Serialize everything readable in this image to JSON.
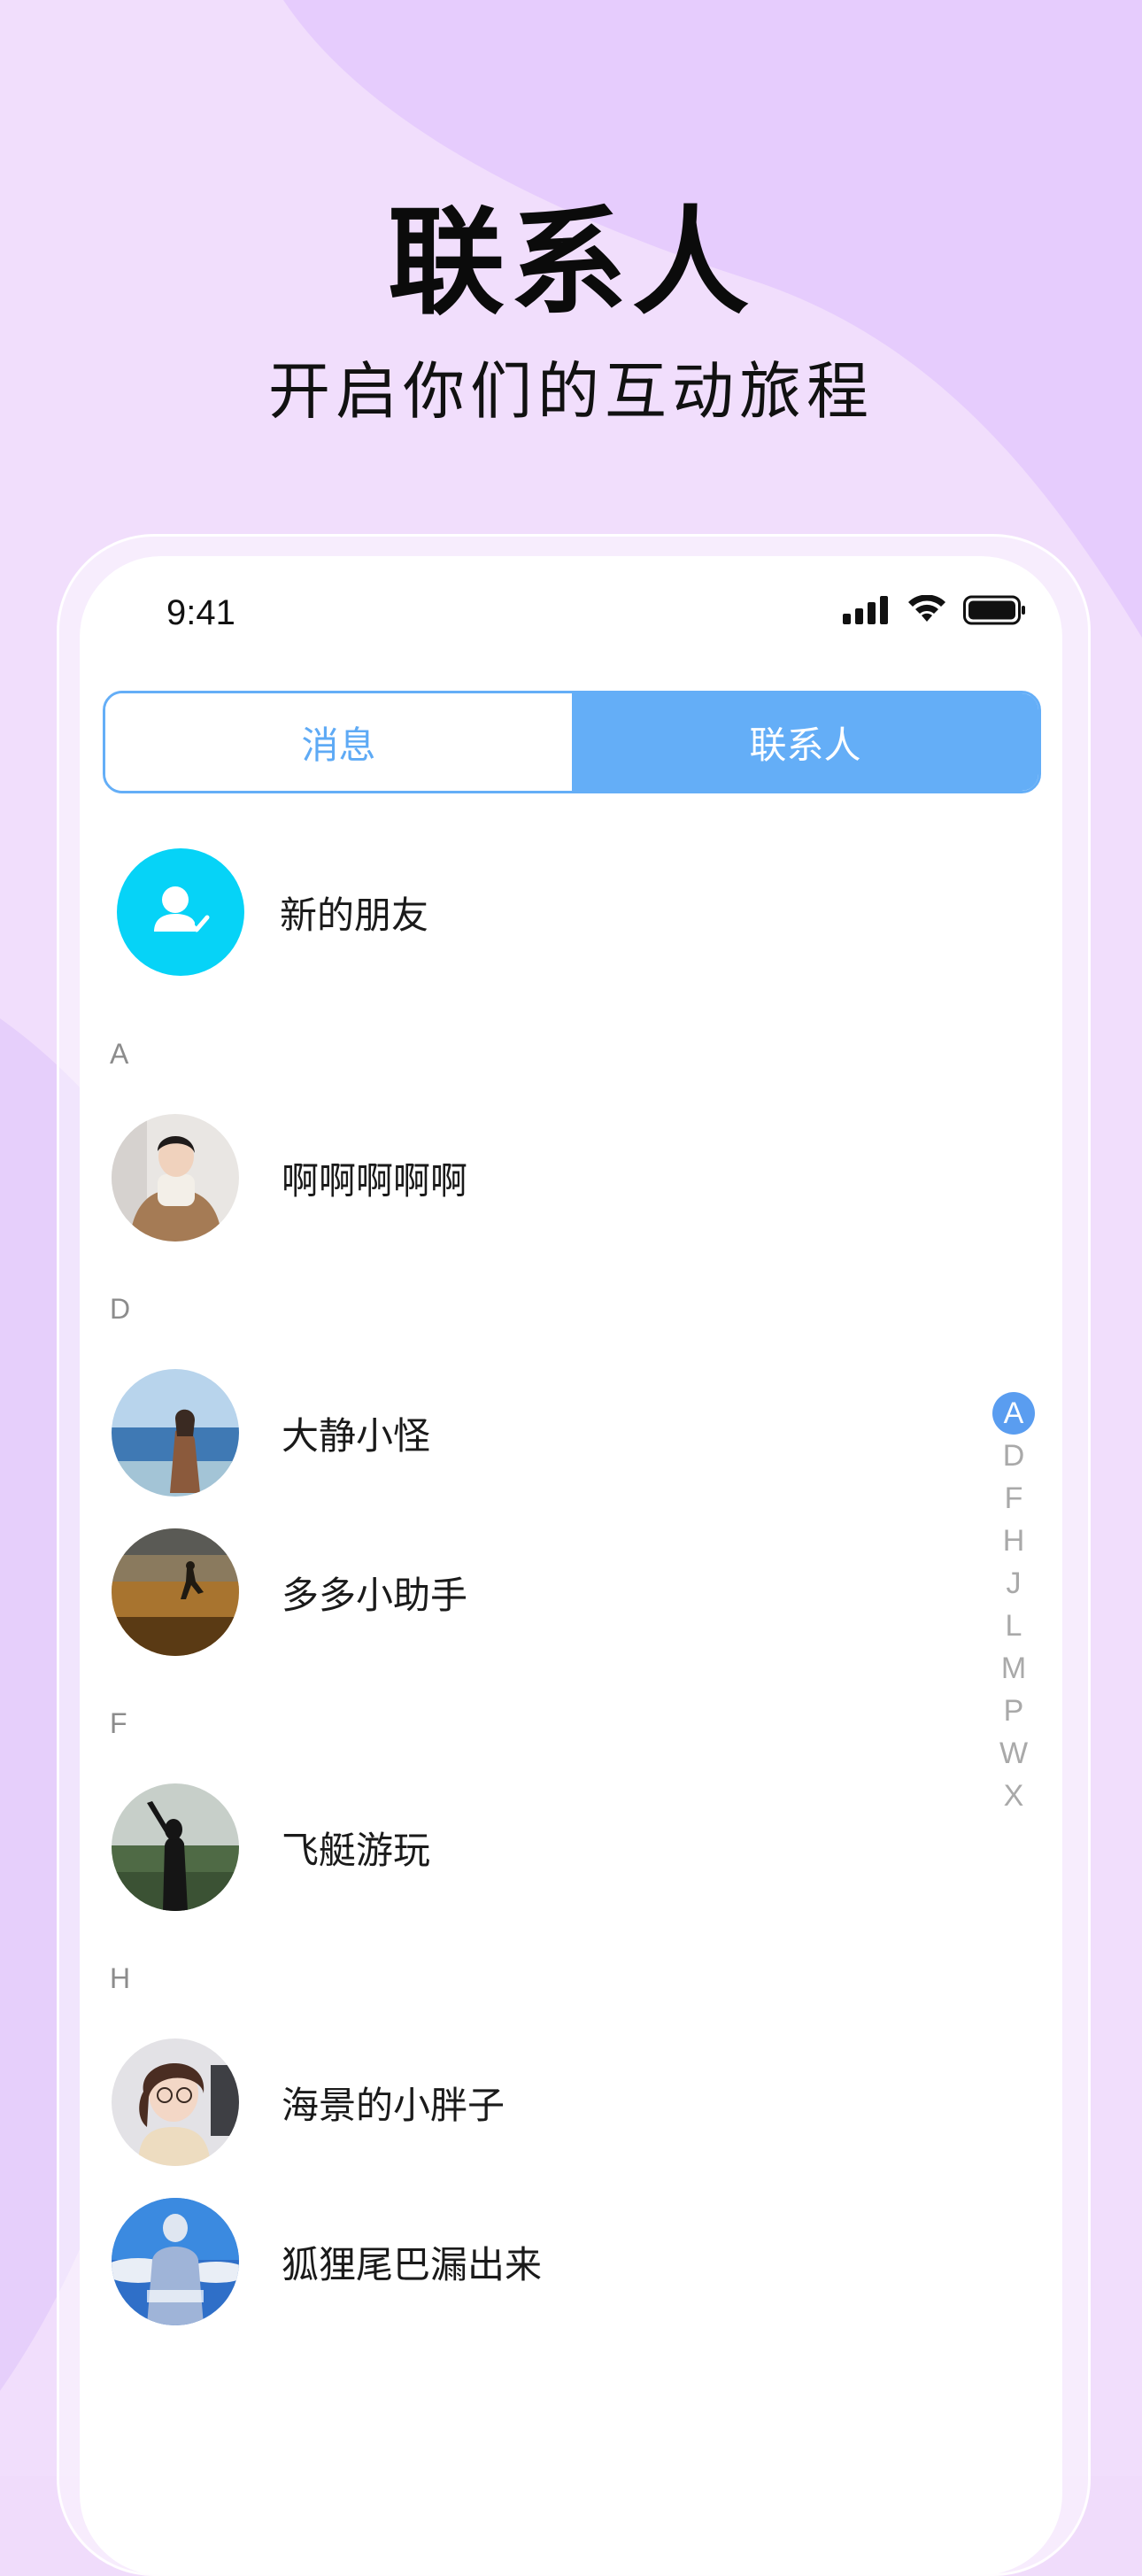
{
  "hero": {
    "title": "联系人",
    "subtitle": "开启你们的互动旅程"
  },
  "status_bar": {
    "time": "9:41"
  },
  "tabs": [
    {
      "label": "消息",
      "active": false
    },
    {
      "label": "联系人",
      "active": true
    }
  ],
  "new_friend": {
    "label": "新的朋友",
    "icon": "user-check-icon"
  },
  "sections": [
    {
      "letter": "A",
      "contacts": [
        {
          "name": "啊啊啊啊啊"
        }
      ]
    },
    {
      "letter": "D",
      "contacts": [
        {
          "name": "大静小怪"
        },
        {
          "name": "多多小助手"
        }
      ]
    },
    {
      "letter": "F",
      "contacts": [
        {
          "name": "飞艇游玩"
        }
      ]
    },
    {
      "letter": "H",
      "contacts": [
        {
          "name": "海景的小胖子"
        },
        {
          "name": "狐狸尾巴漏出来"
        }
      ]
    }
  ],
  "index_letters": [
    "A",
    "D",
    "F",
    "H",
    "J",
    "L",
    "M",
    "P",
    "W",
    "X"
  ],
  "index_active": "A",
  "colors": {
    "accent": "#64aef7",
    "new_friend_bg": "#06d3f7",
    "background": "#f0dcfb"
  }
}
